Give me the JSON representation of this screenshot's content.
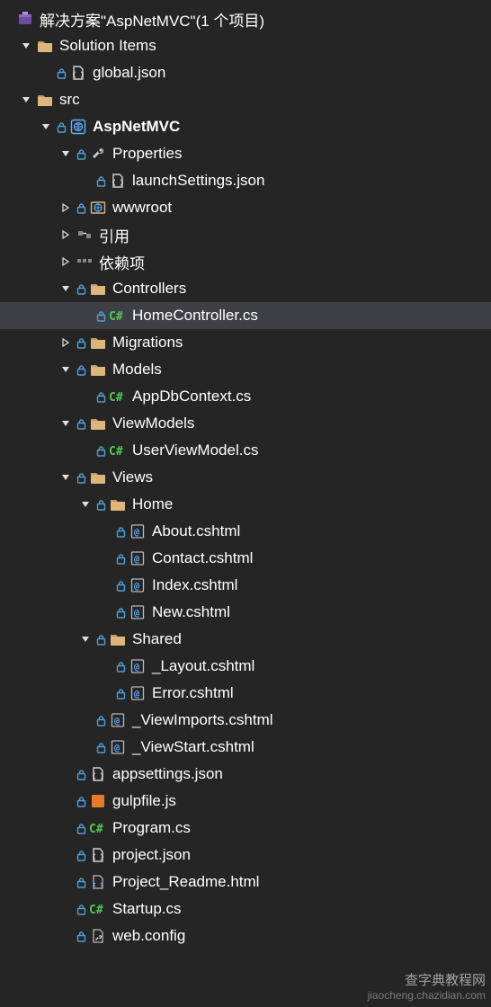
{
  "colors": {
    "bg": "#252526",
    "selected": "#3f3f46",
    "text": "#ffffff",
    "folder": "#dcb67a",
    "arrow": "#e0e0e0",
    "lock": "#4f9fd6",
    "json_strap": "#d0d0d0",
    "csharp": "#4ec94e",
    "cshtml_border": "#b8b8b8",
    "cshtml_at": "#5bb0ff",
    "globe": "#5bb0ff",
    "wrench": "#c8c8c8",
    "js_square": "#e8792a",
    "ref_box": "#888888",
    "html_border": "#b8b8b8",
    "config_wrench": "#d0d0d0"
  },
  "watermark": {
    "line1": "查字典教程网",
    "line2": "jiaocheng.chazidian.com"
  },
  "rows": [
    {
      "indent": 0,
      "arrow": "none",
      "icon": "solution",
      "label": "解决方案\"AspNetMVC\"(1 个项目)",
      "lock": false
    },
    {
      "indent": 1,
      "arrow": "open",
      "icon": "folder",
      "label": "Solution Items",
      "lock": false
    },
    {
      "indent": 2,
      "arrow": "none",
      "icon": "json",
      "label": "global.json",
      "lock": true
    },
    {
      "indent": 1,
      "arrow": "open",
      "icon": "folder",
      "label": "src",
      "lock": false
    },
    {
      "indent": 2,
      "arrow": "open",
      "icon": "globe",
      "label": "AspNetMVC",
      "lock": true,
      "bold": true
    },
    {
      "indent": 3,
      "arrow": "open",
      "icon": "wrench",
      "label": "Properties",
      "lock": true
    },
    {
      "indent": 4,
      "arrow": "none",
      "icon": "json",
      "label": "launchSettings.json",
      "lock": true
    },
    {
      "indent": 3,
      "arrow": "closed",
      "icon": "wwwroot",
      "label": "wwwroot",
      "lock": true
    },
    {
      "indent": 3,
      "arrow": "closed",
      "icon": "refs",
      "label": "引用",
      "lock": false
    },
    {
      "indent": 3,
      "arrow": "closed",
      "icon": "deps",
      "label": "依赖项",
      "lock": false
    },
    {
      "indent": 3,
      "arrow": "open",
      "icon": "folder",
      "label": "Controllers",
      "lock": true
    },
    {
      "indent": 4,
      "arrow": "none",
      "icon": "csharp",
      "label": "HomeController.cs",
      "lock": true,
      "selected": true
    },
    {
      "indent": 3,
      "arrow": "closed",
      "icon": "folder",
      "label": "Migrations",
      "lock": true
    },
    {
      "indent": 3,
      "arrow": "open",
      "icon": "folder",
      "label": "Models",
      "lock": true
    },
    {
      "indent": 4,
      "arrow": "none",
      "icon": "csharp",
      "label": "AppDbContext.cs",
      "lock": true
    },
    {
      "indent": 3,
      "arrow": "open",
      "icon": "folder",
      "label": "ViewModels",
      "lock": true
    },
    {
      "indent": 4,
      "arrow": "none",
      "icon": "csharp",
      "label": "UserViewModel.cs",
      "lock": true
    },
    {
      "indent": 3,
      "arrow": "open",
      "icon": "folder",
      "label": "Views",
      "lock": true
    },
    {
      "indent": 4,
      "arrow": "open",
      "icon": "folder",
      "label": "Home",
      "lock": true
    },
    {
      "indent": 5,
      "arrow": "none",
      "icon": "cshtml",
      "label": "About.cshtml",
      "lock": true
    },
    {
      "indent": 5,
      "arrow": "none",
      "icon": "cshtml",
      "label": "Contact.cshtml",
      "lock": true
    },
    {
      "indent": 5,
      "arrow": "none",
      "icon": "cshtml",
      "label": "Index.cshtml",
      "lock": true
    },
    {
      "indent": 5,
      "arrow": "none",
      "icon": "cshtml",
      "label": "New.cshtml",
      "lock": true
    },
    {
      "indent": 4,
      "arrow": "open",
      "icon": "folder",
      "label": "Shared",
      "lock": true
    },
    {
      "indent": 5,
      "arrow": "none",
      "icon": "cshtml",
      "label": "_Layout.cshtml",
      "lock": true
    },
    {
      "indent": 5,
      "arrow": "none",
      "icon": "cshtml",
      "label": "Error.cshtml",
      "lock": true
    },
    {
      "indent": 4,
      "arrow": "none",
      "icon": "cshtml",
      "label": "_ViewImports.cshtml",
      "lock": true
    },
    {
      "indent": 4,
      "arrow": "none",
      "icon": "cshtml",
      "label": "_ViewStart.cshtml",
      "lock": true
    },
    {
      "indent": 3,
      "arrow": "none",
      "icon": "json",
      "label": "appsettings.json",
      "lock": true
    },
    {
      "indent": 3,
      "arrow": "none",
      "icon": "js",
      "label": "gulpfile.js",
      "lock": true
    },
    {
      "indent": 3,
      "arrow": "none",
      "icon": "csharp",
      "label": "Program.cs",
      "lock": true
    },
    {
      "indent": 3,
      "arrow": "none",
      "icon": "json",
      "label": "project.json",
      "lock": true
    },
    {
      "indent": 3,
      "arrow": "none",
      "icon": "html",
      "label": "Project_Readme.html",
      "lock": true
    },
    {
      "indent": 3,
      "arrow": "none",
      "icon": "csharp",
      "label": "Startup.cs",
      "lock": true
    },
    {
      "indent": 3,
      "arrow": "none",
      "icon": "config",
      "label": "web.config",
      "lock": true
    }
  ]
}
